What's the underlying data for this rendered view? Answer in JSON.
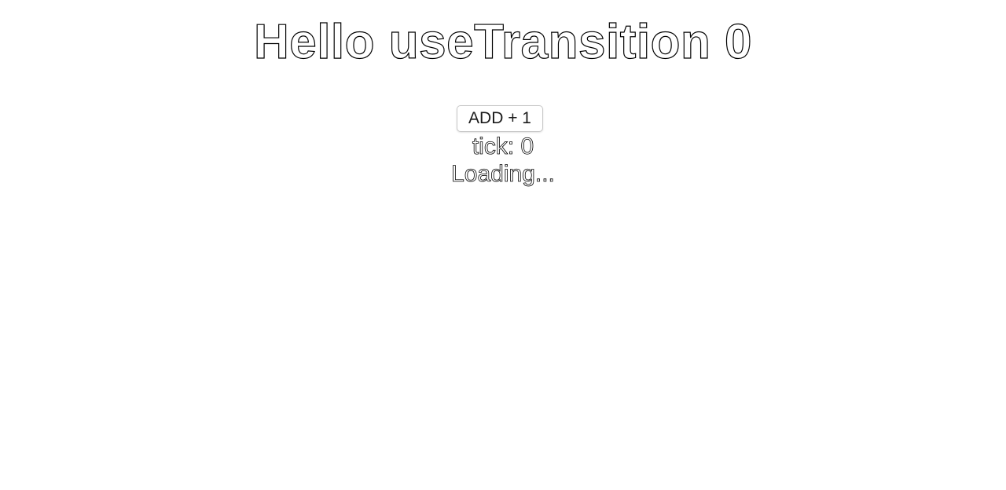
{
  "header": {
    "title": "Hello useTransition 0"
  },
  "controls": {
    "add_button_label": "ADD + 1"
  },
  "status": {
    "tick_text": "tick: 0",
    "loading_text": "Loading..."
  },
  "colors": {
    "background": "#ffffff",
    "text_outline": "#000000",
    "button_border": "#c8c8c8"
  }
}
